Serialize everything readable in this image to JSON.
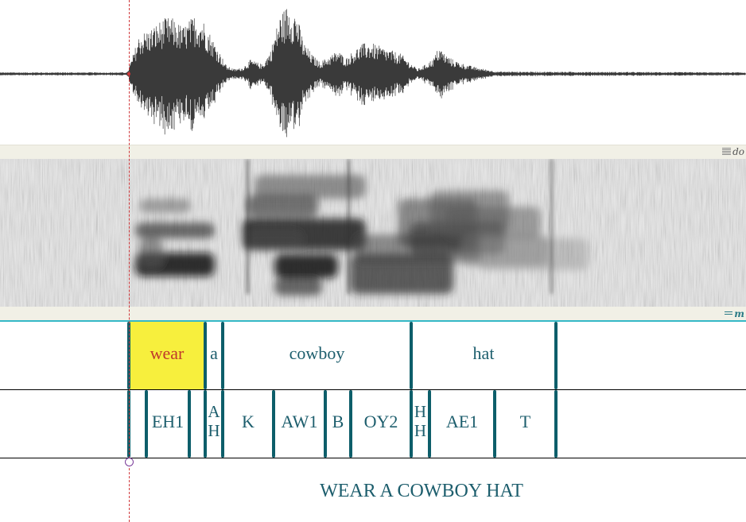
{
  "panels": {
    "spectrogram_tag": "do",
    "tiers_tag": "m"
  },
  "words": [
    {
      "text": "wear",
      "selected": true
    },
    {
      "text": "a",
      "selected": false
    },
    {
      "text": "cowboy",
      "selected": false
    },
    {
      "text": "hat",
      "selected": false
    }
  ],
  "phones": [
    {
      "text": "EH1"
    },
    {
      "text": "A\nH"
    },
    {
      "text": "K"
    },
    {
      "text": "AW1"
    },
    {
      "text": "B"
    },
    {
      "text": "OY2"
    },
    {
      "text": "H\nH"
    },
    {
      "text": "AE1"
    },
    {
      "text": "T"
    }
  ],
  "sentence": "WEAR A COWBOY HAT",
  "colors": {
    "boundary": "#0d5e6a",
    "label": "#1d5e6d",
    "selected_label": "#c0392b",
    "selection_fill": "#f7ef3d",
    "cursor": "#d0393c",
    "waveform": "#3a3a3a"
  }
}
